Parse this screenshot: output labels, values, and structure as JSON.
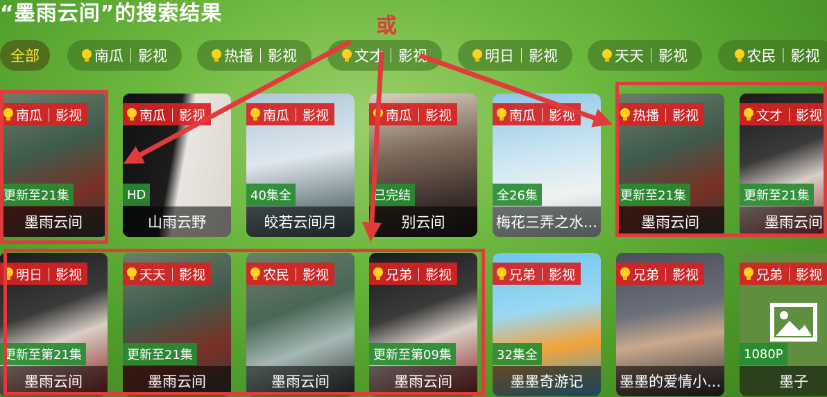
{
  "title": "“墨雨云间”的搜索结果",
  "or_label": "或",
  "filters": [
    {
      "label": "全部",
      "active": true
    },
    {
      "label": "南瓜｜影视",
      "active": false
    },
    {
      "label": "热播｜影视",
      "active": false
    },
    {
      "label": "文才｜影视",
      "active": false
    },
    {
      "label": "明日｜影视",
      "active": false
    },
    {
      "label": "天天｜影视",
      "active": false
    },
    {
      "label": "农民｜影视",
      "active": false
    }
  ],
  "row1": [
    {
      "tag": "南瓜｜影视",
      "badge": "更新至21集",
      "name": "墨雨云间"
    },
    {
      "tag": "南瓜｜影视",
      "badge": "HD",
      "name": "山雨云野"
    },
    {
      "tag": "南瓜｜影视",
      "badge": "40集全",
      "name": "皎若云间月"
    },
    {
      "tag": "南瓜｜影视",
      "badge": "已完结",
      "name": "别云间"
    },
    {
      "tag": "南瓜｜影视",
      "badge": "全26集",
      "name": "梅花三弄之水..."
    },
    {
      "tag": "热播｜影视",
      "badge": "更新至21集",
      "name": "墨雨云间"
    },
    {
      "tag": "文才｜影视",
      "badge": "更新至21集",
      "name": "墨雨云间"
    }
  ],
  "row2": [
    {
      "tag": "明日｜影视",
      "badge": "更新至第21集",
      "name": "墨雨云间"
    },
    {
      "tag": "天天｜影视",
      "badge": "更新至21集",
      "name": "墨雨云间"
    },
    {
      "tag": "农民｜影视",
      "badge": "",
      "name": "墨雨云间"
    },
    {
      "tag": "兄弟｜影视",
      "badge": "更新至第09集",
      "name": "墨雨云间"
    },
    {
      "tag": "兄弟｜影视",
      "badge": "32集全",
      "name": "墨墨奇游记"
    },
    {
      "tag": "兄弟｜影视",
      "badge": "",
      "name": "墨墨的爱情小..."
    },
    {
      "tag": "兄弟｜影视",
      "badge": "1080P",
      "name": "墨子"
    }
  ]
}
